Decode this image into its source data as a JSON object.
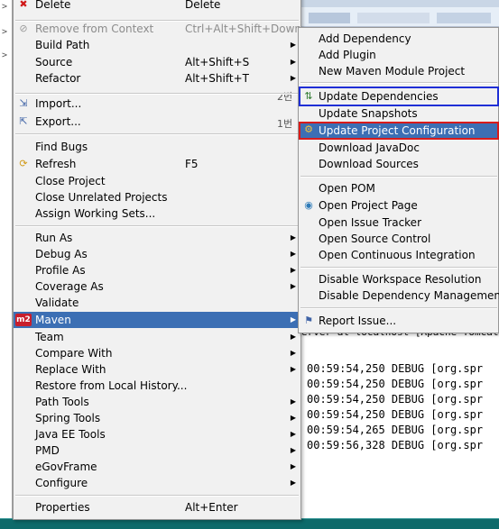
{
  "background": {
    "tree_glyphs": [
      ">",
      ">",
      ">"
    ],
    "console_header": "erver at localhost [Apache Tomcat] C:\\",
    "log_lines": [
      "00:59:54,250 DEBUG [org.spr",
      "00:59:54,250 DEBUG [org.spr",
      "00:59:54,250 DEBUG [org.spr",
      "00:59:54,250 DEBUG [org.spr",
      "00:59:54,265 DEBUG [org.spr",
      "00:59:56,328 DEBUG [org.spr"
    ]
  },
  "menu": {
    "delete": {
      "label": "Delete",
      "accel": "Delete",
      "icon": "delete-icon"
    },
    "remove_from_context": {
      "label": "Remove from Context",
      "accel": "Ctrl+Alt+Shift+Down",
      "icon": "remove-context-icon"
    },
    "build_path": {
      "label": "Build Path"
    },
    "source": {
      "label": "Source",
      "accel": "Alt+Shift+S"
    },
    "refactor": {
      "label": "Refactor",
      "accel": "Alt+Shift+T"
    },
    "import": {
      "label": "Import...",
      "icon": "import-icon"
    },
    "export": {
      "label": "Export...",
      "icon": "export-icon"
    },
    "find_bugs": {
      "label": "Find Bugs"
    },
    "refresh": {
      "label": "Refresh",
      "accel": "F5",
      "icon": "refresh-icon"
    },
    "close_project": {
      "label": "Close Project"
    },
    "close_unrelated": {
      "label": "Close Unrelated Projects"
    },
    "assign_working_sets": {
      "label": "Assign Working Sets..."
    },
    "run_as": {
      "label": "Run As"
    },
    "debug_as": {
      "label": "Debug As"
    },
    "profile_as": {
      "label": "Profile As"
    },
    "coverage_as": {
      "label": "Coverage As"
    },
    "validate": {
      "label": "Validate"
    },
    "maven": {
      "label": "Maven",
      "icon": "m2"
    },
    "team": {
      "label": "Team"
    },
    "compare_with": {
      "label": "Compare With"
    },
    "replace_with": {
      "label": "Replace With"
    },
    "restore_history": {
      "label": "Restore from Local History..."
    },
    "path_tools": {
      "label": "Path Tools"
    },
    "spring_tools": {
      "label": "Spring Tools"
    },
    "java_ee_tools": {
      "label": "Java EE Tools"
    },
    "pmd": {
      "label": "PMD"
    },
    "egovframe": {
      "label": "eGovFrame"
    },
    "configure": {
      "label": "Configure"
    },
    "properties": {
      "label": "Properties",
      "accel": "Alt+Enter"
    },
    "arrow_glyph": "▶"
  },
  "annotations": {
    "note_2": "2번",
    "note_1": "1번"
  },
  "maven_submenu": {
    "add_dependency": "Add Dependency",
    "add_plugin": "Add Plugin",
    "new_module": "New Maven Module Project",
    "update_dependencies": "Update Dependencies",
    "update_snapshots": "Update Snapshots",
    "update_project_config": "Update Project Configuration",
    "download_javadoc": "Download JavaDoc",
    "download_sources": "Download Sources",
    "open_pom": "Open POM",
    "open_project_page": "Open Project Page",
    "open_issue_tracker": "Open Issue Tracker",
    "open_source_control": "Open Source Control",
    "open_ci": "Open Continuous Integration",
    "disable_workspace": "Disable Workspace Resolution",
    "disable_dependency_mgmt": "Disable Dependency Management",
    "report_issue": "Report Issue..."
  },
  "colors": {
    "highlight": "#3c6fb4",
    "box_blue": "#1f2fd6",
    "box_red": "#d81b1b",
    "taskbar": "#0d6a6a"
  }
}
